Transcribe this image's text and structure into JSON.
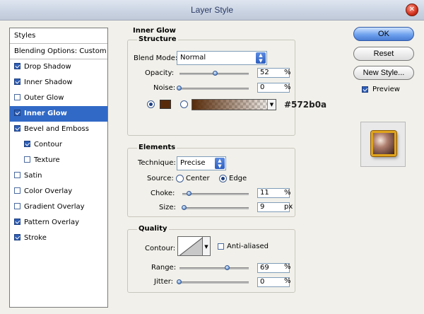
{
  "window": {
    "title": "Layer Style",
    "close_glyph": "✕"
  },
  "styles_list": {
    "header": "Styles",
    "blending": "Blending Options: Custom",
    "items": [
      {
        "label": "Drop Shadow",
        "checked": true
      },
      {
        "label": "Inner Shadow",
        "checked": true
      },
      {
        "label": "Outer Glow",
        "checked": false
      },
      {
        "label": "Inner Glow",
        "checked": true,
        "selected": true
      },
      {
        "label": "Bevel and Emboss",
        "checked": true
      },
      {
        "label": "Contour",
        "checked": true,
        "indent": true
      },
      {
        "label": "Texture",
        "checked": false,
        "indent": true
      },
      {
        "label": "Satin",
        "checked": false
      },
      {
        "label": "Color Overlay",
        "checked": false
      },
      {
        "label": "Gradient Overlay",
        "checked": false
      },
      {
        "label": "Pattern Overlay",
        "checked": true
      },
      {
        "label": "Stroke",
        "checked": true
      }
    ]
  },
  "panel": {
    "title": "Inner Glow",
    "structure": {
      "title": "Structure",
      "blend_mode_label": "Blend Mode:",
      "blend_mode_value": "Normal",
      "opacity_label": "Opacity:",
      "opacity_value": "52",
      "opacity_fraction": 0.52,
      "noise_label": "Noise:",
      "noise_value": "0",
      "noise_fraction": 0,
      "percent": "%",
      "color_hex": "#572b0a",
      "color_radio_selected": "solid"
    },
    "elements": {
      "title": "Elements",
      "technique_label": "Technique:",
      "technique_value": "Precise",
      "source_label": "Source:",
      "source_center": "Center",
      "source_edge": "Edge",
      "source_selected": "edge",
      "choke_label": "Choke:",
      "choke_value": "11",
      "choke_fraction": 0.11,
      "size_label": "Size:",
      "size_value": "9",
      "size_fraction": 0.036,
      "px": "px"
    },
    "quality": {
      "title": "Quality",
      "contour_label": "Contour:",
      "anti_aliased_label": "Anti-aliased",
      "anti_aliased": false,
      "range_label": "Range:",
      "range_value": "69",
      "range_fraction": 0.69,
      "jitter_label": "Jitter:",
      "jitter_value": "0",
      "jitter_fraction": 0
    }
  },
  "buttons": {
    "ok": "OK",
    "reset": "Reset",
    "new_style": "New Style...",
    "preview_label": "Preview",
    "preview_checked": true
  },
  "colors": {
    "selected_bg": "#3169c6",
    "accent": "#2f5fb8",
    "glow_color": "#572b0a"
  }
}
